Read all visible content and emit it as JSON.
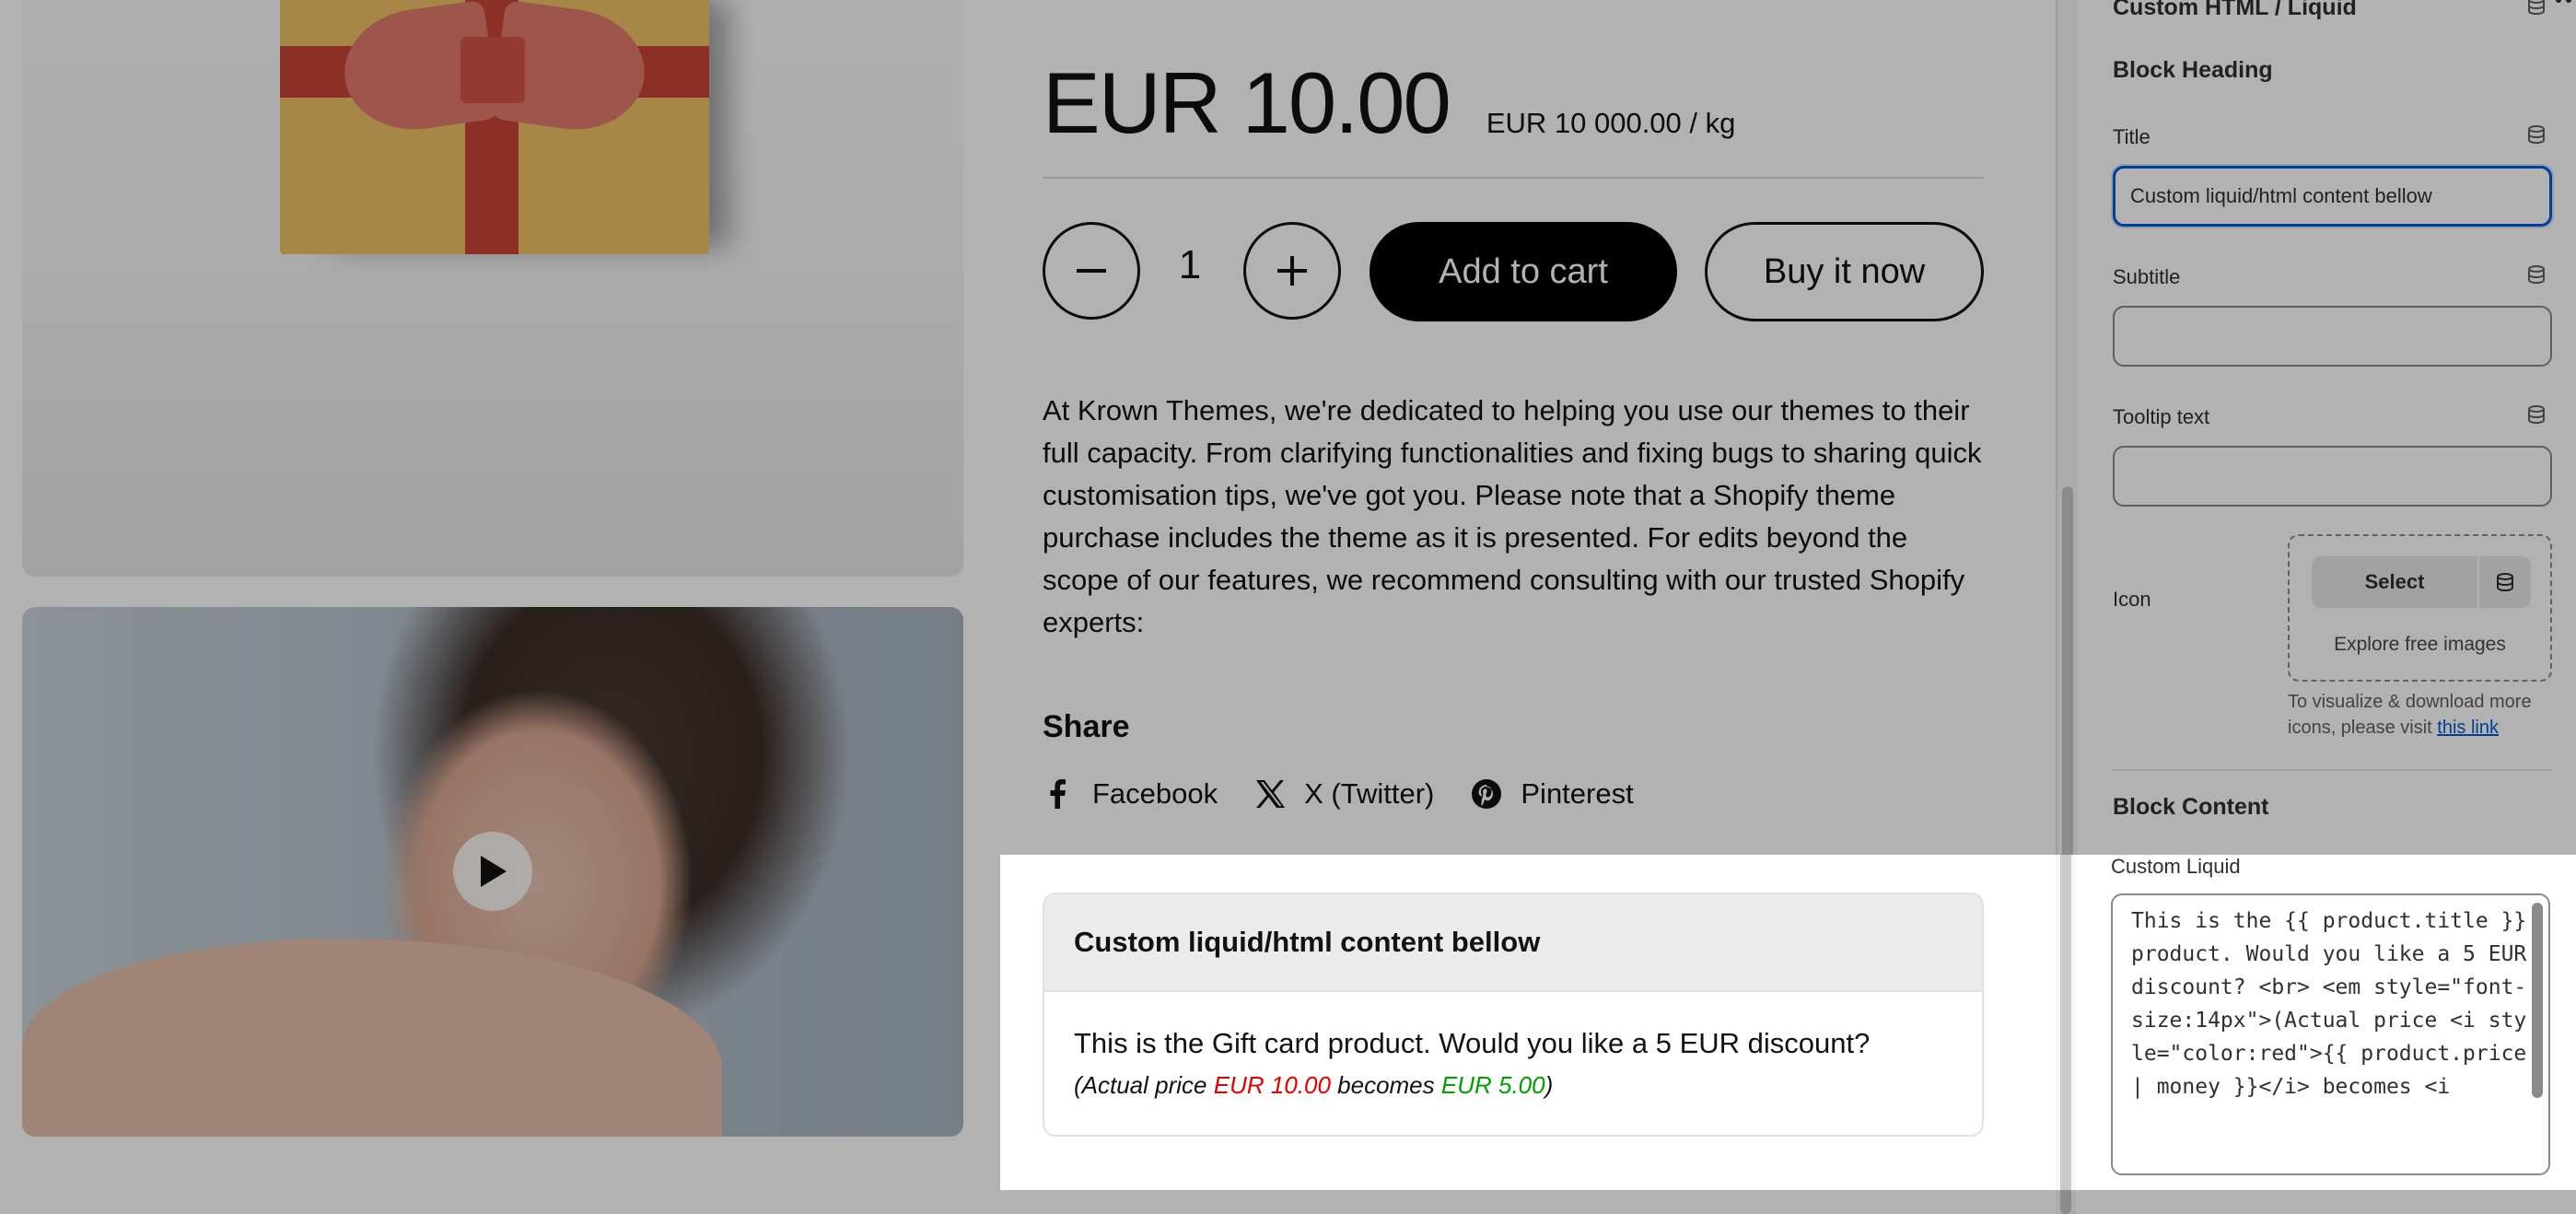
{
  "product": {
    "price": "EUR 10.00",
    "unit_price": "EUR 10 000.00 / kg",
    "quantity": "1",
    "add_to_cart_label": "Add to cart",
    "buy_now_label": "Buy it now",
    "description": "At Krown Themes, we're dedicated to helping you use our themes to their full capacity. From clarifying functionalities and fixing bugs to sharing quick customisation tips, we've got you. Please note that a Shopify theme purchase includes the theme as it is presented. For edits beyond the scope of our features, we recommend consulting with our trusted Shopify experts:",
    "share": {
      "heading": "Share",
      "links": [
        {
          "label": "Facebook",
          "icon": "facebook-icon"
        },
        {
          "label": "X (Twitter)",
          "icon": "x-twitter-icon"
        },
        {
          "label": "Pinterest",
          "icon": "pinterest-icon"
        }
      ]
    }
  },
  "custom_block": {
    "heading": "Custom liquid/html content bellow",
    "line1": "This is the Gift card product. Would you like a 5 EUR discount?",
    "line2_prefix": "(Actual price ",
    "actual_price": "EUR 10.00",
    "line2_middle": " becomes ",
    "new_price": "EUR 5.00",
    "line2_suffix": ")",
    "colors": {
      "actual_price": "#e50000",
      "new_price": "#00a000"
    }
  },
  "editor": {
    "panel_title": "Custom HTML / Liquid",
    "block_heading_section": "Block Heading",
    "title_label": "Title",
    "title_value": "Custom liquid/html content bellow",
    "subtitle_label": "Subtitle",
    "subtitle_value": "",
    "tooltip_label": "Tooltip text",
    "tooltip_value": "",
    "icon_label": "Icon",
    "select_label": "Select",
    "explore_label": "Explore free images",
    "icon_help_text": "To visualize & download more icons, please visit ",
    "icon_help_link": "this link",
    "block_content_section": "Block Content",
    "custom_liquid_label": "Custom Liquid",
    "custom_liquid_value": "This is the {{ product.title }} product. Would you like a 5 EUR discount? <br> <em style=\"font-size:14px\">(Actual price <i style=\"color:red\">{{ product.price | money }}</i> becomes <i",
    "focus_color": "#005bd3"
  }
}
